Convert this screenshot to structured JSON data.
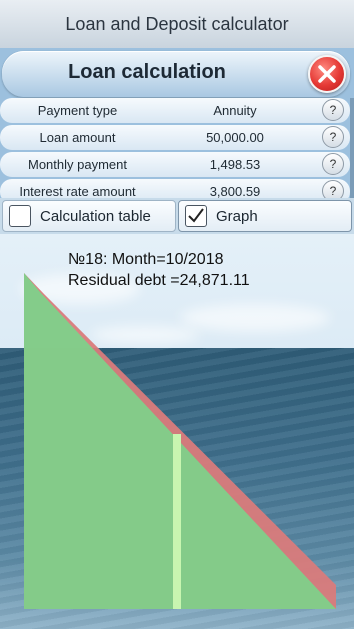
{
  "app_title": "Loan and Deposit calculator",
  "panel": {
    "title": "Loan calculation",
    "rows": [
      {
        "label": "Payment type",
        "value": "Annuity",
        "help": "?"
      },
      {
        "label": "Loan amount",
        "value": "50,000.00",
        "help": "?"
      },
      {
        "label": "Monthly payment",
        "value": "1,498.53",
        "help": "?"
      },
      {
        "label": "Interest rate amount",
        "value": "3,800.59",
        "help": "?"
      }
    ]
  },
  "tabs": {
    "table_label": "Calculation table",
    "table_checked": false,
    "graph_label": "Graph",
    "graph_checked": true
  },
  "graph": {
    "line1": "№18: Month=10/2018",
    "line2": "Residual debt =24,871.11",
    "selected_index": 18,
    "months": 36,
    "colors": {
      "debt": "#7fd08a",
      "interest": "#d97b7b",
      "selected": "#c8f5b0"
    }
  }
}
